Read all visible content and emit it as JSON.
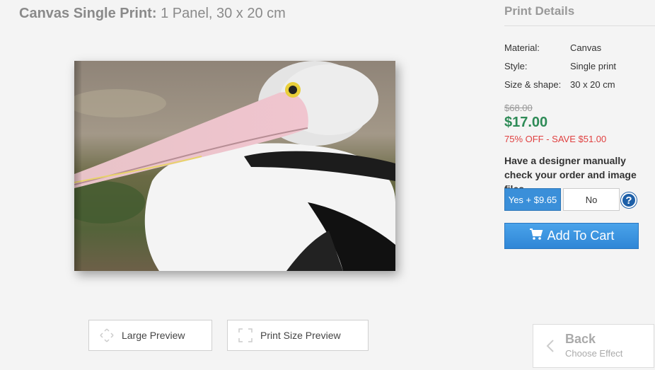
{
  "title": {
    "bold": "Canvas Single Print:",
    "rest": "1 Panel, 30 x 20 cm"
  },
  "preview": {
    "large_label": "Large Preview",
    "size_label": "Print Size Preview"
  },
  "details": {
    "heading": "Print Details",
    "rows": [
      {
        "key": "Material:",
        "value": "Canvas"
      },
      {
        "key": "Style:",
        "value": "Single print"
      },
      {
        "key": "Size & shape:",
        "value": "30 x 20 cm"
      }
    ],
    "old_price": "$68.00",
    "new_price": "$17.00",
    "discount": "75% OFF - SAVE $51.00",
    "designer_question": "Have a designer manually check your order and image files",
    "yes_label": "Yes + $9.65",
    "no_label": "No",
    "help": "?",
    "cart_label": "Add To Cart"
  },
  "back": {
    "label": "Back",
    "sub": "Choose Effect"
  },
  "icons": [
    "expand-icon",
    "crop-frame-icon",
    "help-icon",
    "cart-icon",
    "chevron-left-icon"
  ],
  "colors": {
    "accent_blue": "#3a8fd9",
    "price_green": "#2e8b57",
    "discount_red": "#e04040",
    "help_blue": "#1d5fa8"
  }
}
